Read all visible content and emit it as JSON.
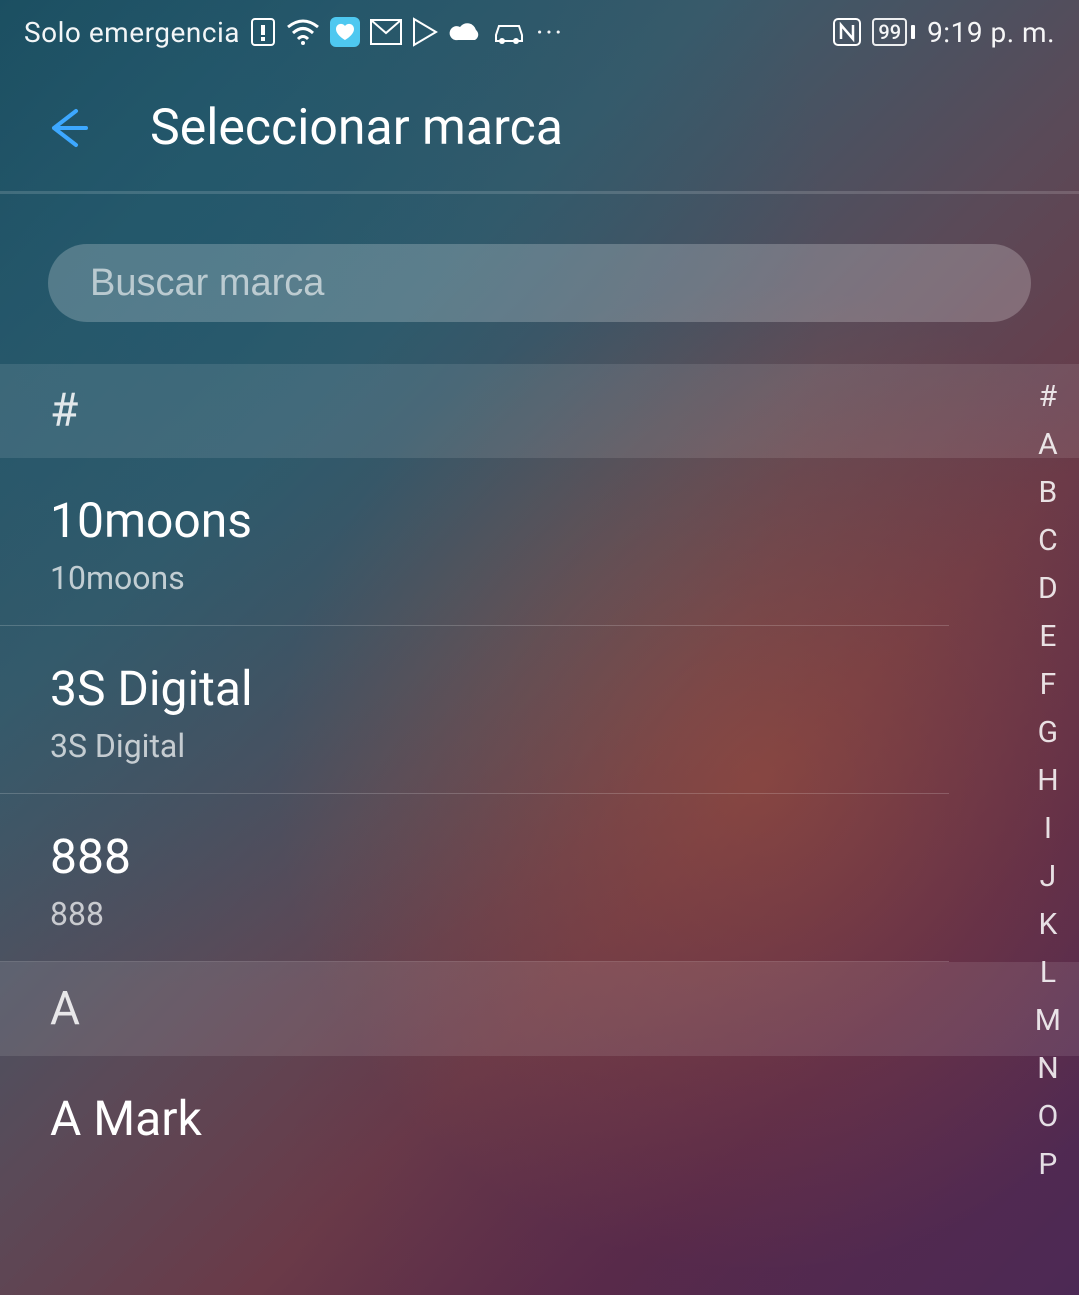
{
  "status": {
    "carrier": "Solo emergencia",
    "battery": "99",
    "time": "9:19 p. m."
  },
  "header": {
    "title": "Seleccionar marca"
  },
  "search": {
    "placeholder": "Buscar marca"
  },
  "sections": [
    {
      "letter": "#",
      "items": [
        {
          "title": "10moons",
          "sub": "10moons"
        },
        {
          "title": "3S Digital",
          "sub": "3S Digital"
        },
        {
          "title": "888",
          "sub": "888"
        }
      ]
    },
    {
      "letter": "A",
      "items": [
        {
          "title": "A Mark",
          "sub": ""
        }
      ]
    }
  ],
  "alpha_index": [
    "#",
    "A",
    "B",
    "C",
    "D",
    "E",
    "F",
    "G",
    "H",
    "I",
    "J",
    "K",
    "L",
    "M",
    "N",
    "O",
    "P"
  ]
}
